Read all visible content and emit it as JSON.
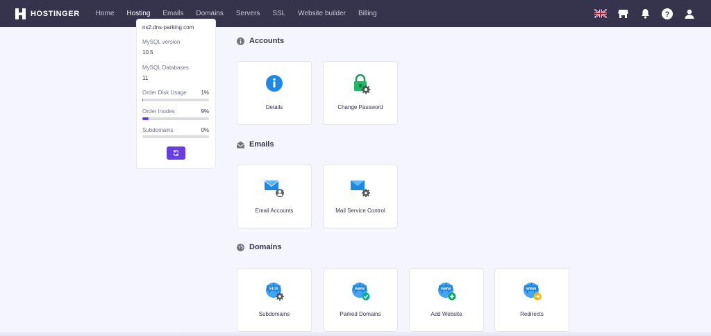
{
  "brand": {
    "name": "HOSTINGER"
  },
  "nav": {
    "items": [
      {
        "label": "Home"
      },
      {
        "label": "Hosting"
      },
      {
        "label": "Emails"
      },
      {
        "label": "Domains"
      },
      {
        "label": "Servers"
      },
      {
        "label": "SSL"
      },
      {
        "label": "Website builder"
      },
      {
        "label": "Billing"
      }
    ],
    "active": "Hosting",
    "icons": [
      "uk-flag-icon",
      "store-icon",
      "bell-icon",
      "help-icon",
      "user-icon"
    ]
  },
  "sidebar": {
    "partial_text": "ns2.dns-parking.com",
    "mysql_version_label": "MySQL version",
    "mysql_version_value": "10.5",
    "mysql_db_label": "MySQL Databases",
    "mysql_db_value": "11",
    "usage": [
      {
        "label": "Order Disk Usage",
        "percent_text": "1%",
        "fraction": 0.01
      },
      {
        "label": "Order Inodes",
        "percent_text": "9%",
        "fraction": 0.09
      },
      {
        "label": "Subdomains",
        "percent_text": "0%",
        "fraction": 0.0
      }
    ],
    "refresh_icon": "refresh-icon"
  },
  "sections": {
    "accounts": {
      "title": "Accounts",
      "icon": "info-icon",
      "tiles": [
        {
          "label": "Details",
          "icon": "info-circle-icon"
        },
        {
          "label": "Change Password",
          "icon": "lock-gear-icon"
        }
      ]
    },
    "emails": {
      "title": "Emails",
      "icon": "envelope-open-icon",
      "tiles": [
        {
          "label": "Email Accounts",
          "icon": "mail-user-icon"
        },
        {
          "label": "Mail Service Control",
          "icon": "mail-gear-icon"
        }
      ]
    },
    "domains": {
      "title": "Domains",
      "icon": "globe-icon",
      "tiles": [
        {
          "label": "Subdomains",
          "icon": "globe-sub-gear-icon"
        },
        {
          "label": "Parked Domains",
          "icon": "globe-www-check-icon"
        },
        {
          "label": "Add Website",
          "icon": "globe-www-plus-icon"
        },
        {
          "label": "Redirects",
          "icon": "globe-www-arrow-icon"
        }
      ]
    }
  },
  "colors": {
    "topbar": "#36344d",
    "background": "#f4f5ff",
    "accent": "#673de6",
    "icon_blue": "#1e88e5",
    "icon_green": "#00b090"
  }
}
